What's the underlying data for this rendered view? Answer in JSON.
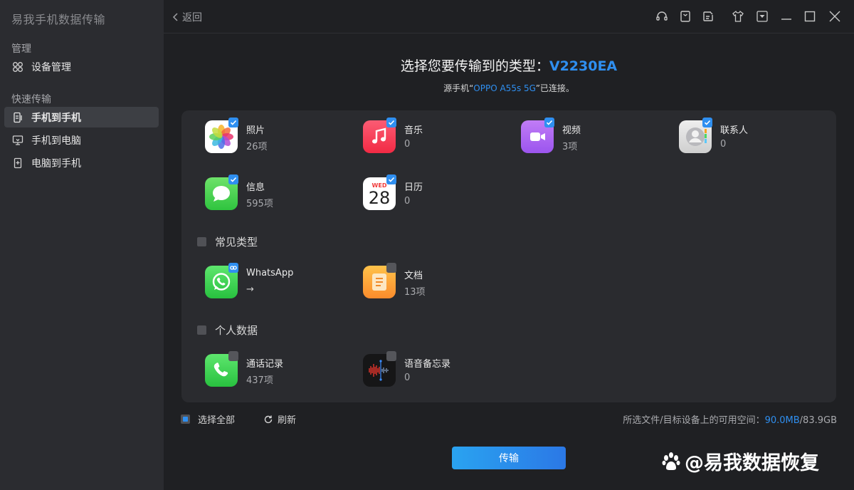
{
  "app": {
    "title": "易我手机数据传输"
  },
  "sidebar": {
    "sections": [
      {
        "label": "管理",
        "items": [
          {
            "label": "设备管理",
            "icon": "device-manage-icon",
            "active": false
          }
        ]
      },
      {
        "label": "快速传输",
        "items": [
          {
            "label": "手机到手机",
            "icon": "phone-to-phone-icon",
            "active": true
          },
          {
            "label": "手机到电脑",
            "icon": "phone-to-pc-icon",
            "active": false
          },
          {
            "label": "电脑到手机",
            "icon": "pc-to-phone-icon",
            "active": false
          }
        ]
      }
    ]
  },
  "topbar": {
    "back_label": "返回",
    "icons": [
      "headset-icon",
      "bookmark-icon",
      "edit-icon",
      "tshirt-icon",
      "menu-dropdown-icon",
      "minimize-icon",
      "maximize-icon",
      "close-icon"
    ]
  },
  "header": {
    "title_prefix": "选择您要传输到的类型：",
    "target_device": "V2230EA",
    "sub_prefix": "源手机“",
    "source_device": "OPPO A55s 5G",
    "sub_suffix": "”已连接。"
  },
  "items": {
    "photos": {
      "name": "照片",
      "count": "26项",
      "checked": true,
      "icon": "photos-icon"
    },
    "music": {
      "name": "音乐",
      "count": "0",
      "checked": true,
      "icon": "music-icon"
    },
    "video": {
      "name": "视频",
      "count": "3项",
      "checked": true,
      "icon": "video-icon"
    },
    "contacts": {
      "name": "联系人",
      "count": "0",
      "checked": true,
      "icon": "contacts-icon"
    },
    "messages": {
      "name": "信息",
      "count": "595项",
      "checked": true,
      "icon": "messages-icon"
    },
    "calendar": {
      "name": "日历",
      "count": "0",
      "checked": true,
      "icon": "calendar-icon",
      "weekday": "WED",
      "day": "28"
    },
    "whatsapp": {
      "name": "WhatsApp",
      "count": "→",
      "checked": false,
      "icon": "whatsapp-icon"
    },
    "documents": {
      "name": "文档",
      "count": "13项",
      "checked": false,
      "icon": "document-icon"
    },
    "calls": {
      "name": "通话记录",
      "count": "437项",
      "checked": false,
      "icon": "phone-call-icon"
    },
    "voice_memos": {
      "name": "语音备忘录",
      "count": "0",
      "checked": false,
      "icon": "voice-memo-icon"
    }
  },
  "groups": {
    "common": {
      "label": "常见类型"
    },
    "personal": {
      "label": "个人数据"
    }
  },
  "footer": {
    "select_all": "选择全部",
    "refresh": "刷新",
    "space_label": "所选文件/目标设备上的可用空间：",
    "selected_size": "90.0MB",
    "total_size": "/83.9GB",
    "transfer_button": "传输"
  },
  "watermark": {
    "text": "@易我数据恢复"
  },
  "colors": {
    "accent": "#2f8ff0",
    "sidebar_bg": "#2b2c30",
    "main_bg": "#1f2023",
    "panel_bg": "#2a2b2f"
  }
}
